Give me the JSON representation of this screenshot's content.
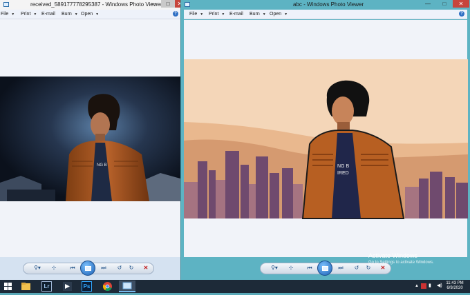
{
  "left_window": {
    "title": "received_589177778295387 - Windows Photo Viewer",
    "menu": [
      "File",
      "Print",
      "E-mail",
      "Burn",
      "Open"
    ],
    "help": "?",
    "controls": {
      "minimize": "—",
      "maximize": "□",
      "close": "✕"
    }
  },
  "right_window": {
    "title": "abc - Windows Photo Viewer",
    "menu": [
      "File",
      "Print",
      "E-mail",
      "Burn",
      "Open"
    ],
    "help": "?",
    "controls": {
      "minimize": "—",
      "maximize": "□",
      "close": "✕"
    }
  },
  "player_controls": {
    "zoom": "⚲▾",
    "fit": "⊹",
    "prev": "⏮",
    "next": "⏭",
    "rotate_ccw": "↺",
    "rotate_cw": "↻",
    "delete": "✕"
  },
  "watermark": {
    "line1": "Activate Windows",
    "line2": "Go to Settings to activate Windows."
  },
  "taskbar": {
    "apps": [
      "windows-start-icon",
      "file-explorer-icon",
      "lightroom-icon",
      "video-editor-icon",
      "photoshop-icon",
      "chrome-icon",
      "photo-viewer-icon"
    ],
    "lightroom_label": "Lr",
    "photoshop_label": "Ps",
    "tray_arrow": "▲",
    "time": "11:43 PM",
    "date": "6/9/2020"
  },
  "colors": {
    "window_frame_active": "#5db3c3",
    "taskbar": "#1d2a38",
    "close_button": "#c7453b",
    "canvas": "#f1f3f9"
  }
}
